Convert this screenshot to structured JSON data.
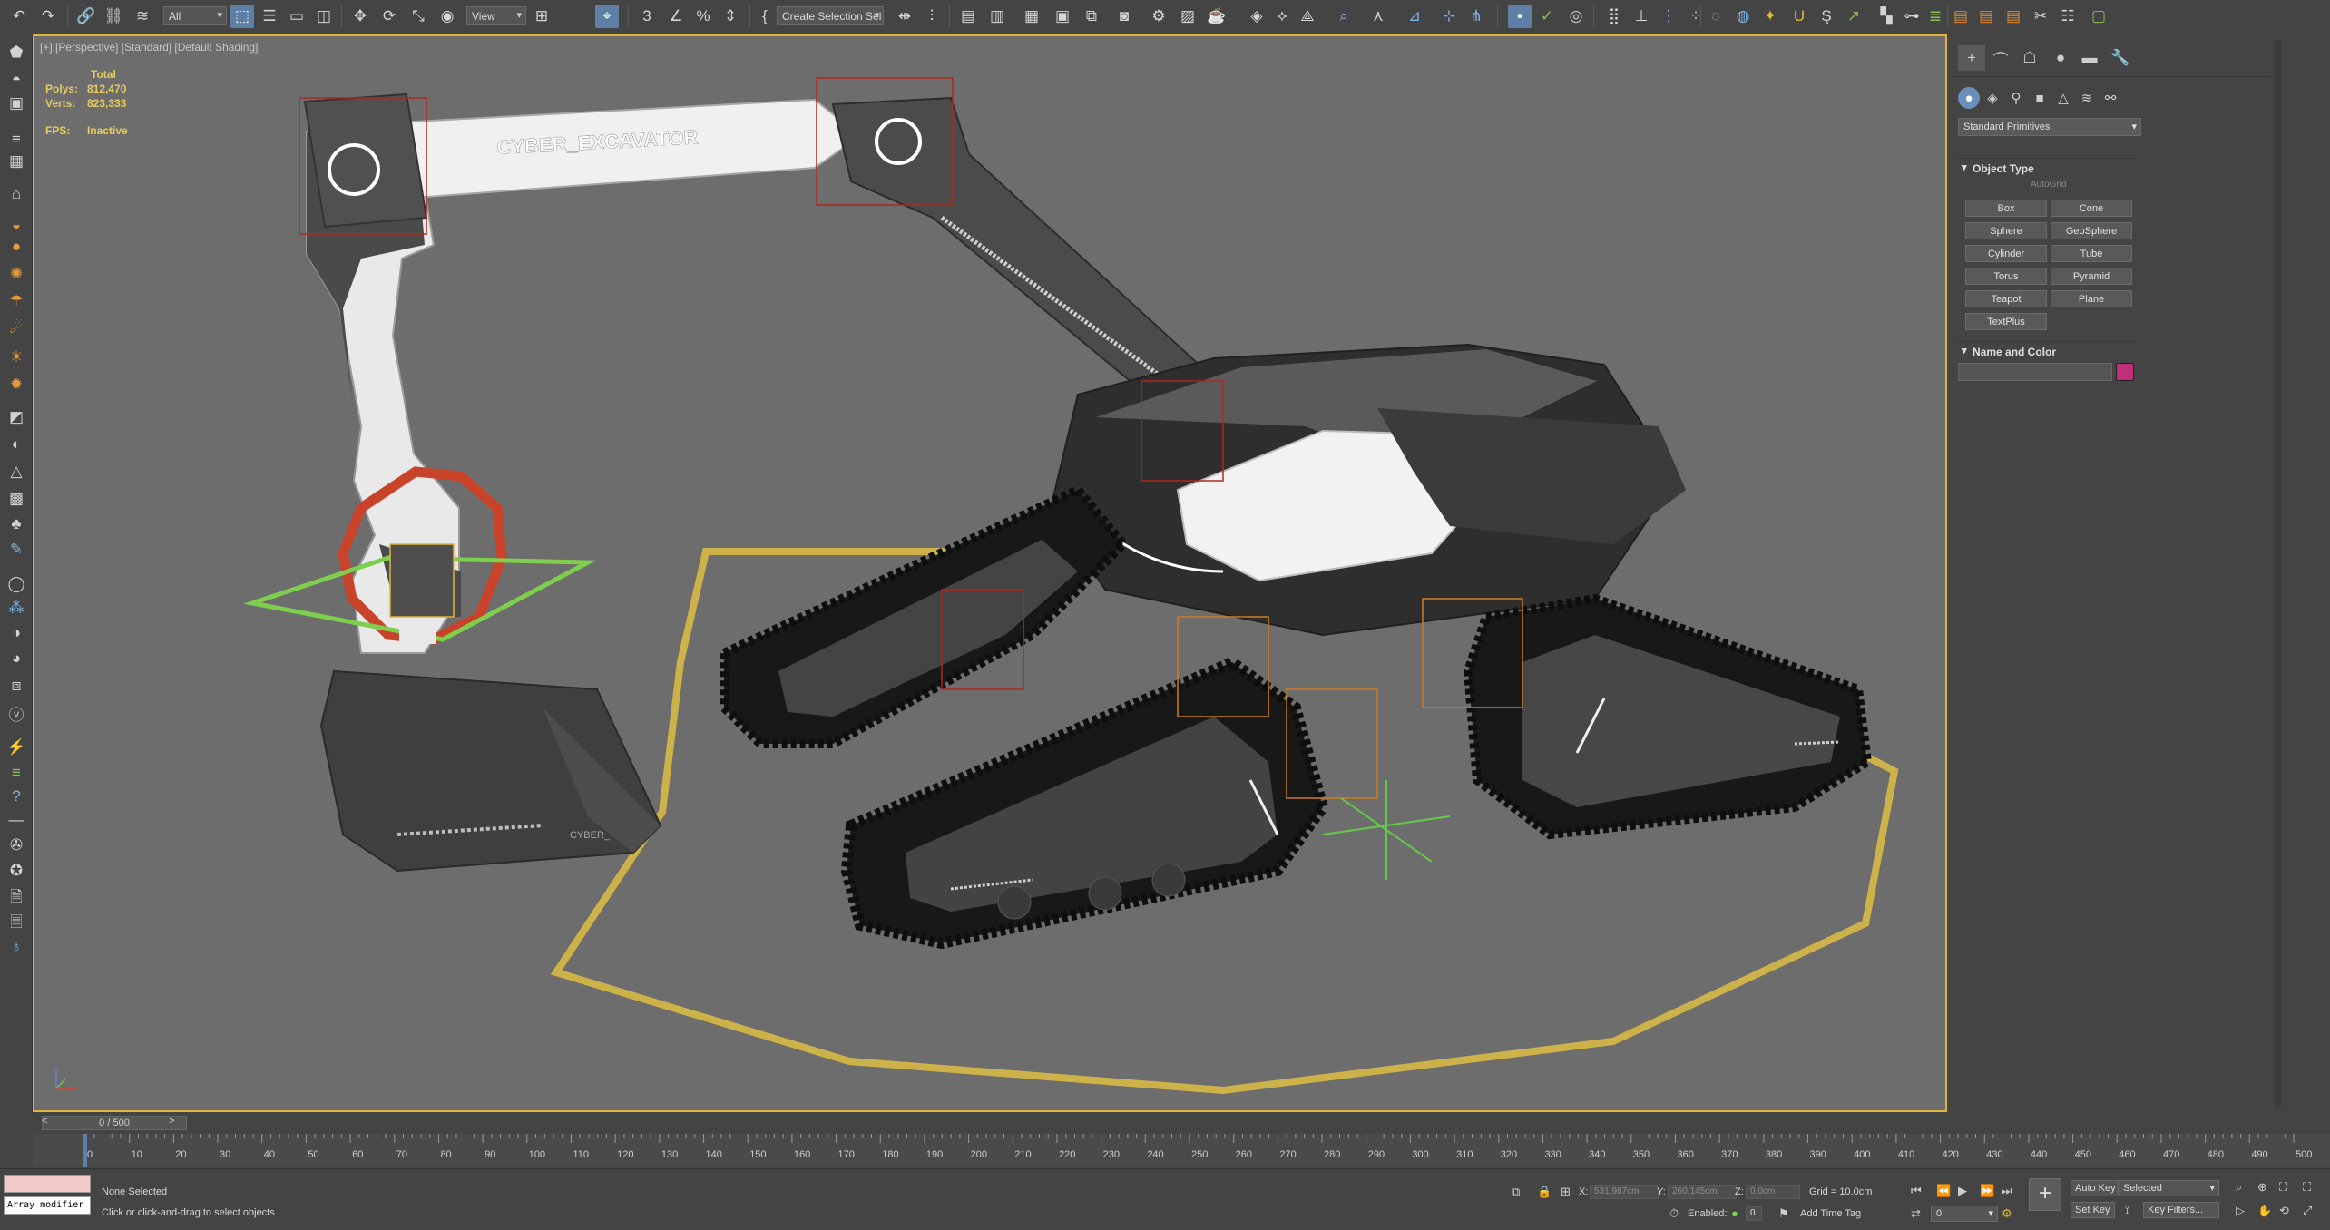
{
  "toolbar": {
    "selection_filter": "All",
    "ref_coord": "View",
    "selection_set": "Create Selection Sel"
  },
  "viewport": {
    "label": "[+] [Perspective] [Standard] [Default Shading]",
    "stats": {
      "total_label": "Total",
      "polys_label": "Polys:",
      "polys_value": "812,470",
      "verts_label": "Verts:",
      "verts_value": "823,333",
      "fps_label": "FPS:",
      "fps_value": "Inactive"
    },
    "model_text": "CYBER_EXCAVATOR",
    "bucket_text": "CYBER_"
  },
  "command_panel": {
    "category": "Standard Primitives",
    "object_type_title": "Object Type",
    "autogrid": "AutoGrid",
    "primitives": [
      "Box",
      "Cone",
      "Sphere",
      "GeoSphere",
      "Cylinder",
      "Tube",
      "Torus",
      "Pyramid",
      "Teapot",
      "Plane",
      "TextPlus"
    ],
    "name_color_title": "Name and Color",
    "swatch_color": "#c0307a"
  },
  "timeline": {
    "slider": "0 / 500",
    "ticks": [
      "0",
      "10",
      "20",
      "30",
      "40",
      "50",
      "60",
      "70",
      "80",
      "90",
      "100",
      "110",
      "120",
      "130",
      "140",
      "150",
      "160",
      "170",
      "180",
      "190",
      "200",
      "210",
      "220",
      "230",
      "240",
      "250",
      "260",
      "270",
      "280",
      "290",
      "300",
      "310",
      "320",
      "330",
      "340",
      "350",
      "360",
      "370",
      "380",
      "390",
      "400",
      "410",
      "420",
      "430",
      "440",
      "450",
      "460",
      "470",
      "480",
      "490",
      "500"
    ]
  },
  "status": {
    "script_text": "Array modifier",
    "selection": "None Selected",
    "prompt": "Click or click-and-drag to select objects",
    "x_label": "X:",
    "x_value": "531.987cm",
    "y_label": "Y:",
    "y_value": "260.145cm",
    "z_label": "Z:",
    "z_value": "0.0cm",
    "grid": "Grid = 10.0cm",
    "enabled_label": "Enabled:",
    "enabled_value": "0",
    "add_time_tag": "Add Time Tag",
    "auto_key": "Auto Key",
    "set_key": "Set Key",
    "selected": "Selected",
    "key_filters": "Key Filters...",
    "frame": "0"
  },
  "colors": {
    "viewport_bg": "#6d6d6d",
    "active_border": "#e0b33c",
    "stats_text": "#e7cb5c",
    "spline_yellow": "#cdb24a",
    "gizmo_green": "#7fcf4e",
    "gizmo_red": "#c8432a"
  }
}
